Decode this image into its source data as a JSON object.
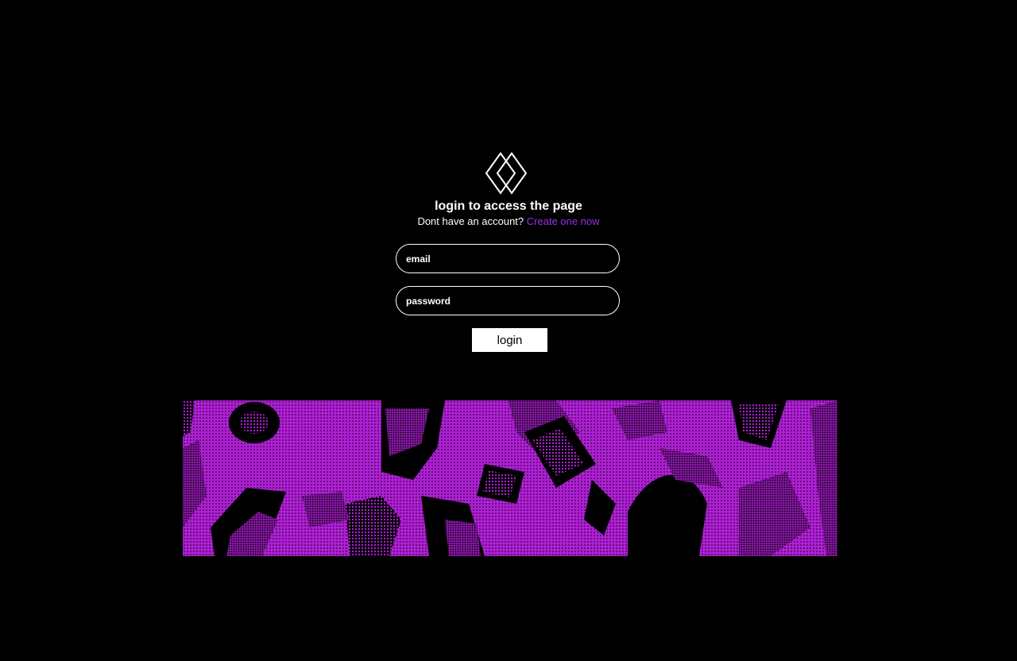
{
  "logo": {
    "icon": "diamond-logo-icon"
  },
  "heading": "login to access the page",
  "signup": {
    "prompt": "Dont have an account?",
    "link_label": "Create one now"
  },
  "form": {
    "email_placeholder": "email",
    "password_placeholder": "password",
    "submit_label": "login"
  },
  "banner": {
    "icon": "abstract-halftone-artwork",
    "colors": {
      "primary": "#b01fd6",
      "background": "#000000"
    }
  },
  "colors": {
    "background": "#000000",
    "text": "#ffffff",
    "accent": "#9b30e8",
    "button_bg": "#ffffff",
    "button_text": "#000000"
  }
}
